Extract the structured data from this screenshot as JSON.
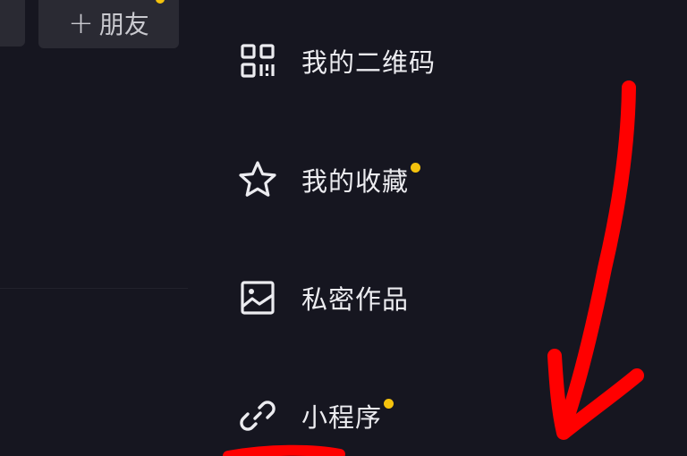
{
  "top_bar": {
    "add_friend_plus": "+",
    "add_friend_label": "朋友"
  },
  "menu": {
    "items": [
      {
        "label": "我的二维码",
        "icon": "qr-code-icon",
        "has_dot": false
      },
      {
        "label": "我的收藏",
        "icon": "star-icon",
        "has_dot": true
      },
      {
        "label": "私密作品",
        "icon": "image-icon",
        "has_dot": false
      },
      {
        "label": "小程序",
        "icon": "link-icon",
        "has_dot": true
      }
    ]
  },
  "colors": {
    "background": "#161620",
    "text": "#ececf0",
    "badge": "#f4c20d",
    "annotation_arrow": "#ff0000"
  }
}
